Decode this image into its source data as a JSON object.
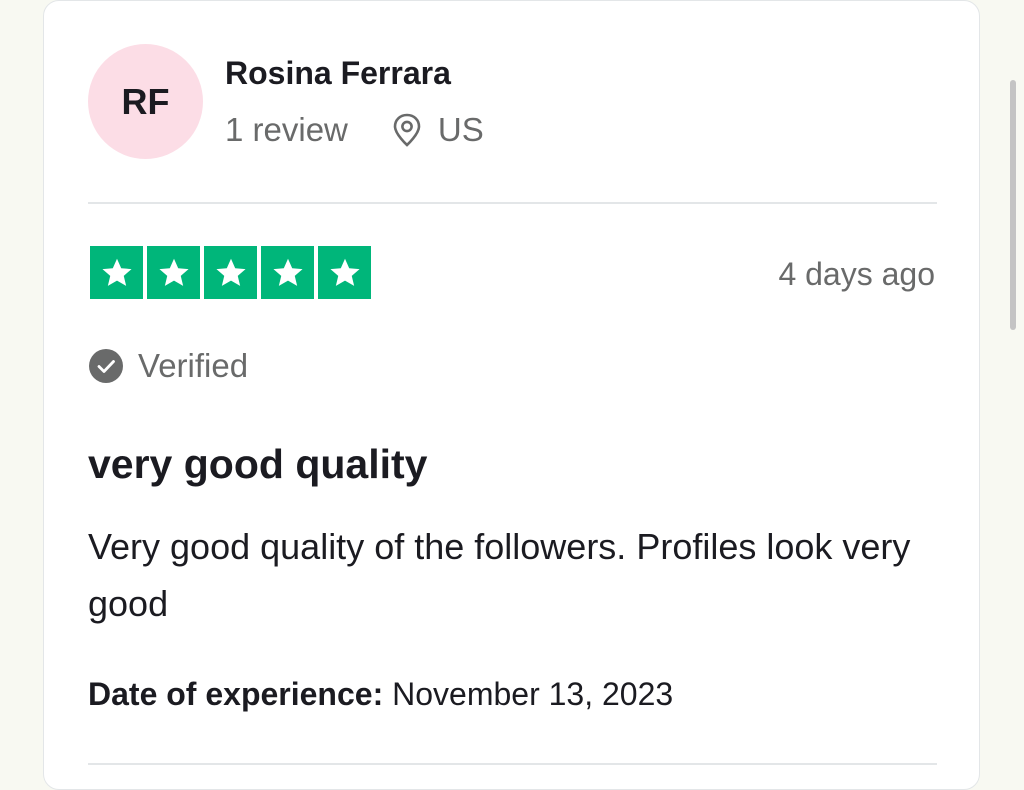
{
  "reviewer": {
    "initials": "RF",
    "name": "Rosina Ferrara",
    "review_count": "1 review",
    "location_icon": "map-pin-icon",
    "country": "US"
  },
  "review": {
    "rating": 5,
    "rating_max": 5,
    "posted_ago": "4 days ago",
    "verified_label": "Verified",
    "title": "very good quality",
    "body": "Very good quality of the followers. Profiles look very good",
    "experience_label": "Date of experience:",
    "experience_date": "November 13, 2023"
  },
  "colors": {
    "star_green": "#00b67a",
    "avatar_bg": "#fcdde6",
    "muted_text": "#696a6a",
    "primary_text": "#1b1b21"
  }
}
